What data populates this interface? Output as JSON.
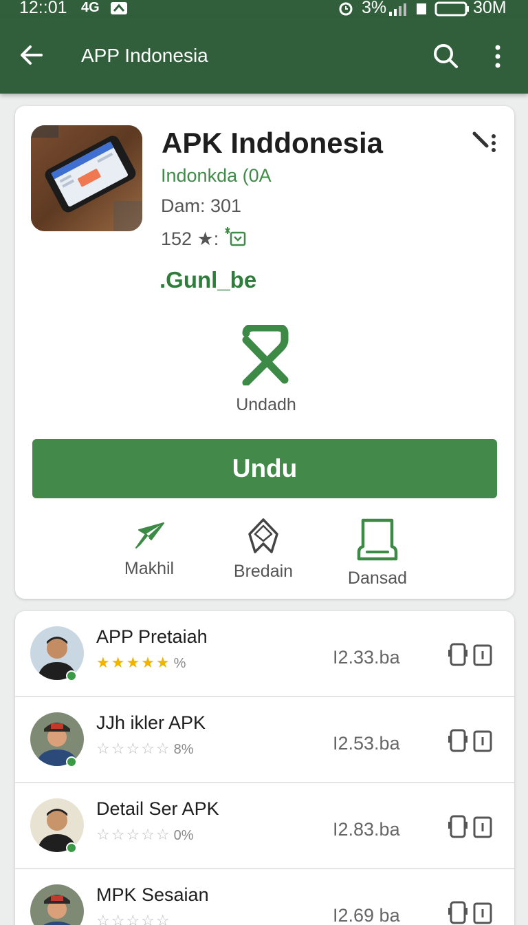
{
  "status_bar": {
    "time": "12::01",
    "network": "4G",
    "battery_pct": "3%",
    "data": "30M"
  },
  "app_bar": {
    "title": "APP Indonesia"
  },
  "app": {
    "name": "APK Inddonesia",
    "developer": "Indonkda (0A",
    "meta": "Dam: 301",
    "rating": "152 ★:",
    "tag": ".Gunl_be"
  },
  "center_action": {
    "label": "Undadh"
  },
  "primary_button": {
    "label": "Undu"
  },
  "actions": [
    {
      "label": "Makhil",
      "icon": "send-icon"
    },
    {
      "label": "Bredain",
      "icon": "star-outline-icon"
    },
    {
      "label": "Dansad",
      "icon": "device-icon"
    }
  ],
  "list": [
    {
      "name": "APP Pretaiah",
      "rating": 5,
      "percent": "%",
      "size": "I2.33.ba"
    },
    {
      "name": "JJh ikler APK",
      "rating": 0,
      "percent": "8%",
      "size": "I2.53.ba"
    },
    {
      "name": "Detail Ser APK",
      "rating": 0,
      "percent": "0%",
      "size": "I2.83.ba"
    },
    {
      "name": "MPK Sesaian",
      "rating": 0,
      "percent": "",
      "size": "I2.69 ba"
    }
  ],
  "colors": {
    "primary": "#325f3b",
    "accent": "#43894a",
    "star": "#f0b400"
  }
}
